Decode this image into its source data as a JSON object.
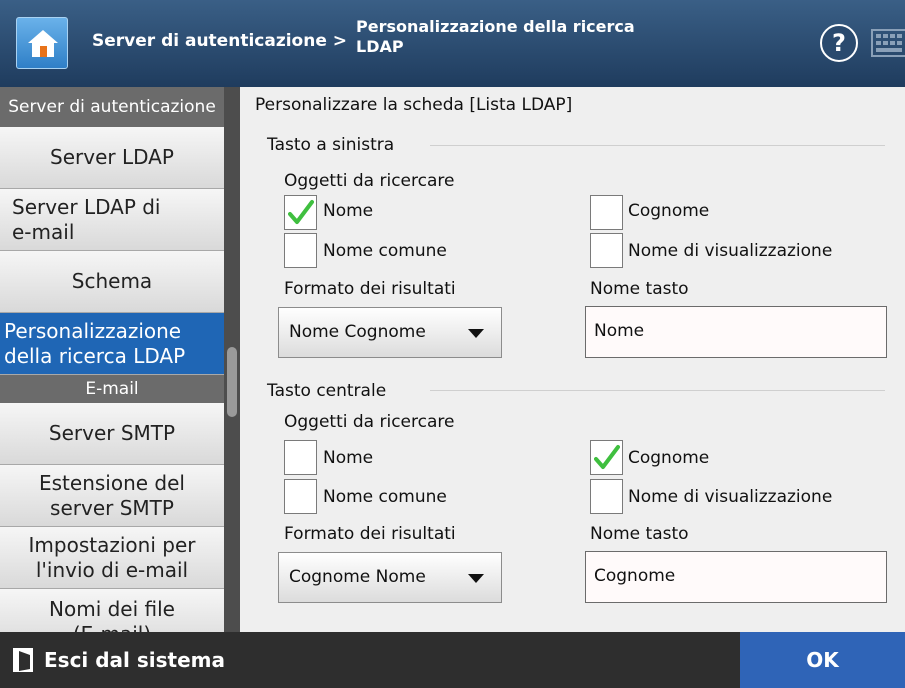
{
  "header": {
    "breadcrumb_prefix": "Server di autenticazione >",
    "current_page": "Personalizzazione della ricerca LDAP",
    "help_symbol": "?"
  },
  "sidebar": {
    "section_auth": "Server di autenticazione",
    "items_auth": [
      {
        "label": "Server LDAP"
      },
      {
        "label": "Server LDAP di e-mail"
      },
      {
        "label": "Schema"
      },
      {
        "label": "Personalizzazione della ricerca LDAP",
        "selected": true
      }
    ],
    "section_email": "E-mail",
    "items_email": [
      {
        "label": "Server SMTP"
      },
      {
        "label": "Estensione del server SMTP"
      },
      {
        "label": "Impostazioni per l'invio di e-mail"
      },
      {
        "label": "Nomi dei file (E-mail)"
      }
    ]
  },
  "main": {
    "title": "Personalizzare la scheda [Lista LDAP]",
    "left_key": {
      "title": "Tasto a sinistra",
      "search_objects_label": "Oggetti da ricercare",
      "options": [
        {
          "label": "Nome",
          "checked": true
        },
        {
          "label": "Cognome",
          "checked": false
        },
        {
          "label": "Nome comune",
          "checked": false
        },
        {
          "label": "Nome di visualizzazione",
          "checked": false
        }
      ],
      "format_label": "Formato dei risultati",
      "format_value": "Nome Cognome",
      "key_name_label": "Nome tasto",
      "key_name_value": "Nome"
    },
    "center_key": {
      "title": "Tasto centrale",
      "search_objects_label": "Oggetti da ricercare",
      "options": [
        {
          "label": "Nome",
          "checked": false
        },
        {
          "label": "Cognome",
          "checked": true
        },
        {
          "label": "Nome comune",
          "checked": false
        },
        {
          "label": "Nome di visualizzazione",
          "checked": false
        }
      ],
      "format_label": "Formato dei risultati",
      "format_value": "Cognome Nome",
      "key_name_label": "Nome tasto",
      "key_name_value": "Cognome"
    }
  },
  "footer": {
    "logout_label": "Esci dal sistema",
    "ok_label": "OK"
  },
  "colors": {
    "header": "#2a4a6e",
    "selected_item": "#1f66b5",
    "ok_button": "#2f64b7",
    "checkmark": "#3fbf3f"
  },
  "icons": {
    "home": "home-icon",
    "help": "help-icon",
    "keyboard": "keyboard-icon",
    "logout": "logout-icon",
    "dropdown": "chevron-down-icon",
    "checkmark": "checkmark-icon"
  }
}
